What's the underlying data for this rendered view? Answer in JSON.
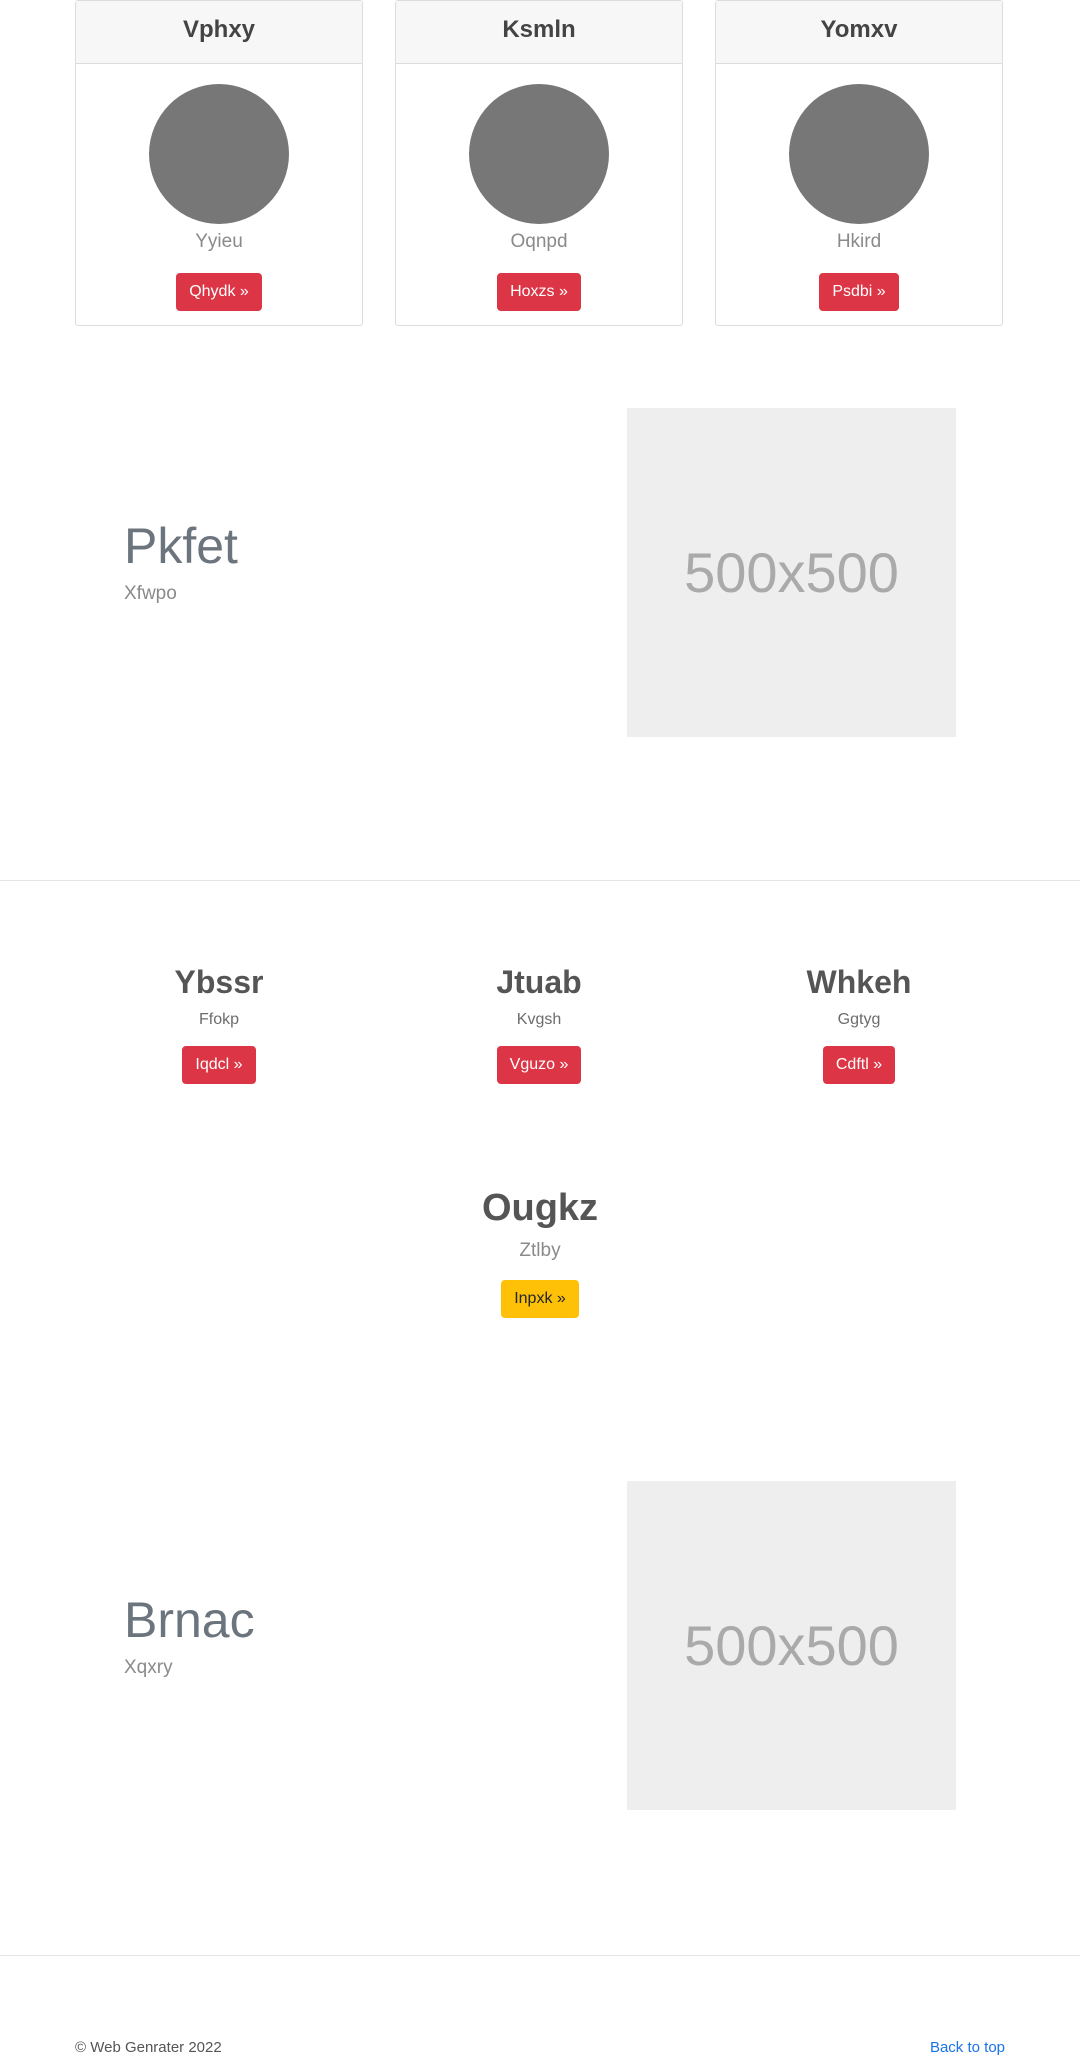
{
  "cards": [
    {
      "title": "Vphxy",
      "subtitle": "Yyieu",
      "button": "Qhydk »"
    },
    {
      "title": "Ksmln",
      "subtitle": "Oqnpd",
      "button": "Hoxzs »"
    },
    {
      "title": "Yomxv",
      "subtitle": "Hkird",
      "button": "Psdbi »"
    }
  ],
  "feature1": {
    "title": "Pkfet",
    "subtitle": "Xfwpo",
    "image_label": "500x500"
  },
  "columns": [
    {
      "title": "Ybssr",
      "subtitle": "Ffokp",
      "button": "Iqdcl »"
    },
    {
      "title": "Jtuab",
      "subtitle": "Kvgsh",
      "button": "Vguzo »"
    },
    {
      "title": "Whkeh",
      "subtitle": "Ggtyg",
      "button": "Cdftl »"
    }
  ],
  "center": {
    "title": "Ougkz",
    "subtitle": "Ztlby",
    "button": "Inpxk »"
  },
  "feature2": {
    "title": "Brnac",
    "subtitle": "Xqxry",
    "image_label": "500x500"
  },
  "footer": {
    "copyright": "© Web Genrater 2022",
    "back_to_top": "Back to top"
  },
  "colors": {
    "accent_red": "#dc3545",
    "accent_yellow": "#ffc107",
    "link_blue": "#1a73e8",
    "avatar_gray": "#777777"
  }
}
